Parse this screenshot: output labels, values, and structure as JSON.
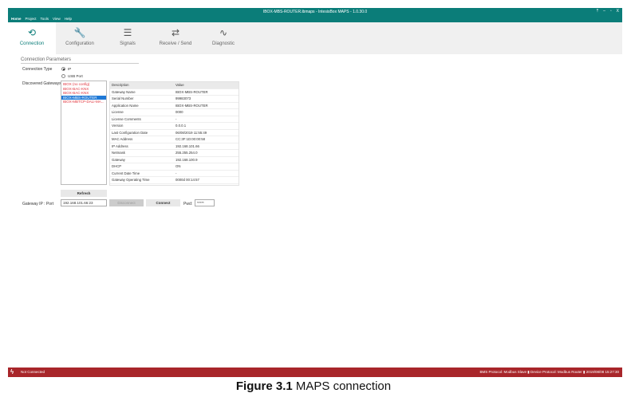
{
  "window": {
    "title": "IBOX-MBS-ROUTER.ibmaps - IntesisBox MAPS - 1.0.30.0",
    "controls": [
      "⤒",
      "–",
      "▫",
      "X"
    ]
  },
  "menu": [
    "Home",
    "Project",
    "Tools",
    "View",
    "Help"
  ],
  "toolbar": [
    {
      "label": "Connection",
      "icon": "connection-icon",
      "glyph": "⟲",
      "active": true
    },
    {
      "label": "Configuration",
      "icon": "wrench-icon",
      "glyph": "🔧"
    },
    {
      "label": "Signals",
      "icon": "list-icon",
      "glyph": "☰"
    },
    {
      "label": "Receive / Send",
      "icon": "transfer-icon",
      "glyph": "⇄"
    },
    {
      "label": "Diagnostic",
      "icon": "pulse-icon",
      "glyph": "∿"
    }
  ],
  "connection": {
    "section_title": "Connection Parameters",
    "type_label": "Connection Type",
    "options": [
      "IP",
      "USB Port"
    ],
    "selected": "IP",
    "gateways_label": "Discovered Gateways",
    "gateways": [
      "IBOX (no config)",
      "IBOX-BAC-KNX",
      "IBOX-BAC-KNX",
      "IBOX-MBS-ROUTER",
      "IBOX-MBTCP-DALI-MA..."
    ],
    "selected_gateway_index": 3,
    "table_headers": [
      "Description",
      "Value"
    ],
    "table_rows": [
      [
        "Gateway Name",
        "IBOX-MBS-ROUTER"
      ],
      [
        "Serial Number",
        "99983073"
      ],
      [
        "Application Name",
        "IBOX-MBS-ROUTER"
      ],
      [
        "License",
        "0000"
      ],
      [
        "License Comments",
        "-"
      ],
      [
        "Version",
        "0.0.0.1"
      ],
      [
        "Last Configuration Date",
        "06/08/2019 11:55:49"
      ],
      [
        "MAC Address",
        "CC:3F:1D:00:00:58"
      ],
      [
        "IP Address",
        "192.168.101.66"
      ],
      [
        "Netmask",
        "255.255.254.0"
      ],
      [
        "Gateway",
        "192.168.100.9"
      ],
      [
        "DHCP",
        "ON"
      ],
      [
        "Current Date Time",
        "-"
      ],
      [
        "Gateway Operating Time",
        "0000d 00:14:57"
      ]
    ],
    "refresh_label": "Refresh",
    "ip_port_label": "Gateway IP : Port",
    "ip_port_value": "192.168.101.66:23",
    "disconnect_label": "Disconnect",
    "connect_label": "Connect",
    "pwd_label": "Pwd:",
    "pwd_value": "*****"
  },
  "status": {
    "text": "Not Connected",
    "right": "BMS Protocol: Modbus Slave  ▮  Device Protocol: Modbus Router  ▮  2019/08/08 15:27:30"
  },
  "caption": {
    "bold": "Figure 3.1",
    "text": " MAPS connection"
  },
  "colors": {
    "titlebar": "#0b7d79",
    "status": "#a8262a",
    "selection": "#1e78d6",
    "gateway_text": "#e0323c"
  }
}
